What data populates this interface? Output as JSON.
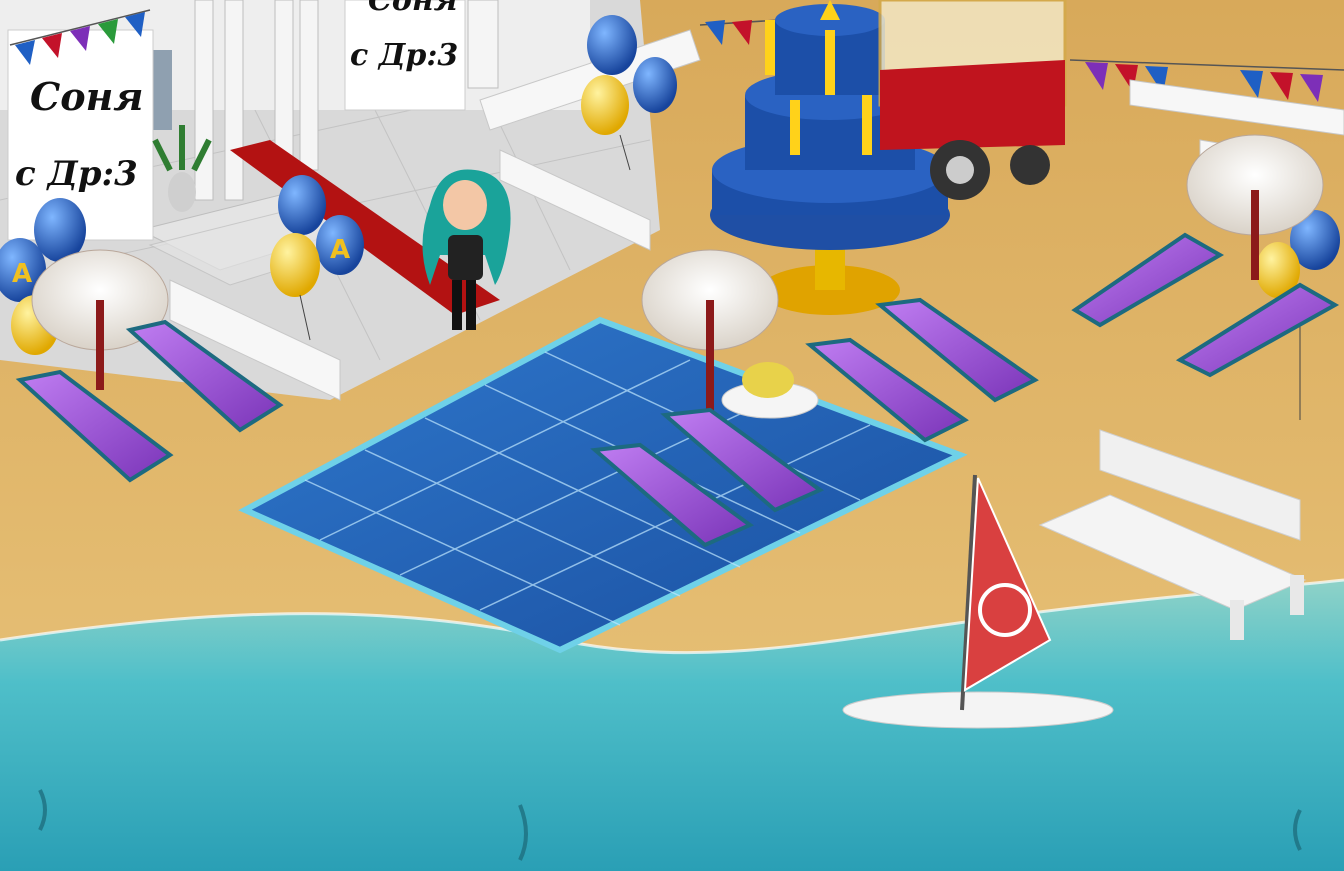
{
  "scene": {
    "type": "isometric-avatar-game-room",
    "setting": "birthday beach party"
  },
  "banners": [
    {
      "line1": "Соня",
      "line2": "с Др:3"
    },
    {
      "line1": "Соня",
      "line2": "с Др:3"
    }
  ],
  "balloons": {
    "letter": "А",
    "colors": [
      "#1f5fc4",
      "#f0c020"
    ]
  },
  "colors": {
    "sand": "#e3b866",
    "sea": "#3fb3c4",
    "pool": "#1d5fb3",
    "lounger": "#9b4fd6",
    "carpet": "#b31212",
    "cake": "#1c4fa8"
  }
}
